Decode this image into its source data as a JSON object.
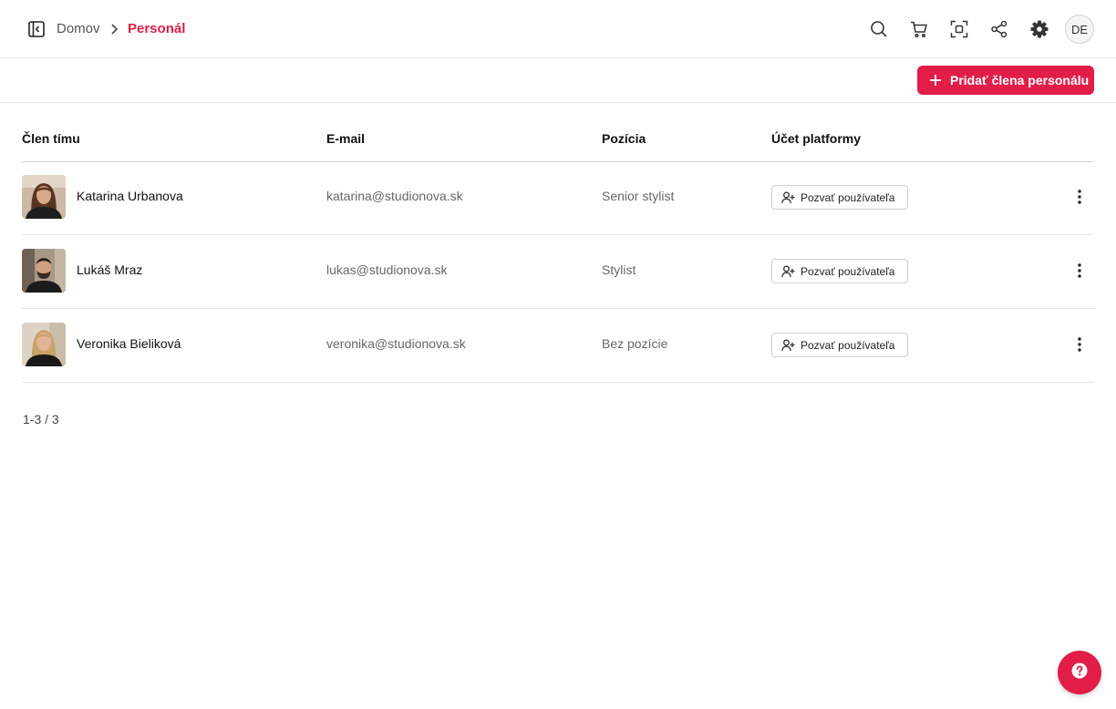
{
  "breadcrumb": {
    "home": "Domov",
    "current": "Personál"
  },
  "header": {
    "icons": [
      "search-icon",
      "cart-icon",
      "scan-icon",
      "share-icon",
      "settings-icon"
    ],
    "user_initials": "DE"
  },
  "toolbar": {
    "add_label": "Pridať člena personálu"
  },
  "table": {
    "columns": [
      "Člen tímu",
      "E-mail",
      "Pozícia",
      "Účet platformy"
    ],
    "rows": [
      {
        "name": "Katarina Urbanova",
        "email": "katarina@studionova.sk",
        "position": "Senior stylist",
        "action": "Pozvať používateľa"
      },
      {
        "name": "Lukáš Mraz",
        "email": "lukas@studionova.sk",
        "position": "Stylist",
        "action": "Pozvať používateľa"
      },
      {
        "name": "Veronika Bieliková",
        "email": "veronika@studionova.sk",
        "position": "Bez pozície",
        "action": "Pozvať používateľa"
      }
    ]
  },
  "pagination": {
    "label": "1-3 / 3"
  },
  "colors": {
    "accent": "#e11d48",
    "border": "#e5e5e5",
    "muted_text": "#666666"
  }
}
